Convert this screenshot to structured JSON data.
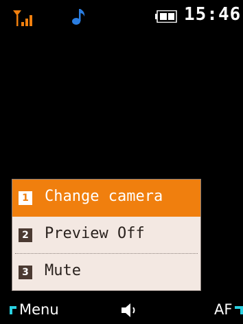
{
  "status_bar": {
    "time": "15:46",
    "signal_icon": "signal-bars-icon",
    "music_icon": "music-note-icon",
    "battery_icon": "battery-icon"
  },
  "menu": {
    "items": [
      {
        "number": "1",
        "label": "Change camera",
        "selected": true
      },
      {
        "number": "2",
        "label": "Preview Off",
        "selected": false
      },
      {
        "number": "3",
        "label": "Mute",
        "selected": false
      }
    ]
  },
  "softkeys": {
    "left": "Menu",
    "center_icon": "speaker-icon",
    "right": "AF"
  },
  "colors": {
    "accent": "#f07f0e",
    "menu_background": "#f3e8e2",
    "badge": "#4b3a32",
    "softkey_corner": "#2ad0e0"
  }
}
